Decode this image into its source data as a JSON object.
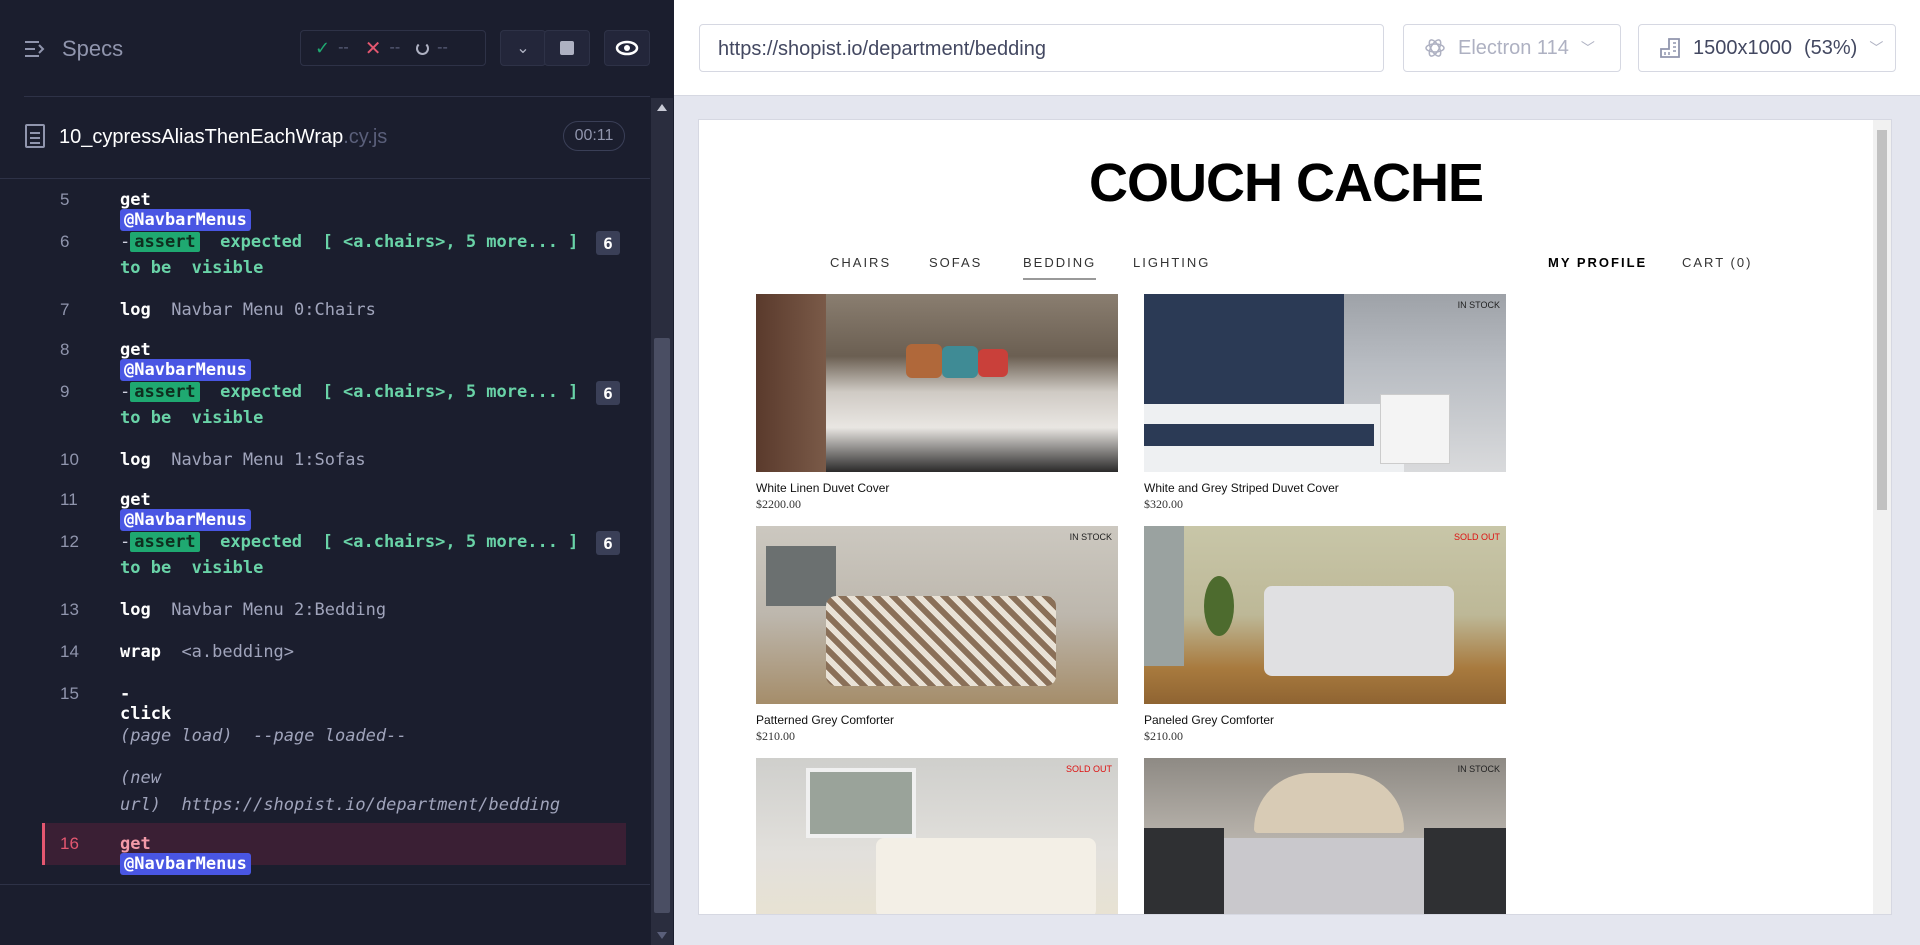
{
  "specs_panel": {
    "label": "Specs",
    "passed": "--",
    "failed": "--",
    "pending": "--"
  },
  "spec_file": {
    "name": "10_cypressAliasThenEachWrap",
    "ext": ".cy.js",
    "duration": "00:11"
  },
  "commands": [
    {
      "num": "5",
      "name": "get",
      "alias": "@NavbarMenus"
    },
    {
      "num": "6",
      "prefix": "-",
      "badge": "assert",
      "text": "expected",
      "target": "[ <a.chairs>, 5 more... ]",
      "count": "6",
      "line2_a": "to be",
      "line2_b": "visible"
    },
    {
      "num": "7",
      "name": "log",
      "message": "Navbar Menu 0:Chairs"
    },
    {
      "num": "8",
      "name": "get",
      "alias": "@NavbarMenus"
    },
    {
      "num": "9",
      "prefix": "-",
      "badge": "assert",
      "text": "expected",
      "target": "[ <a.chairs>, 5 more... ]",
      "count": "6",
      "line2_a": "to be",
      "line2_b": "visible"
    },
    {
      "num": "10",
      "name": "log",
      "message": "Navbar Menu 1:Sofas"
    },
    {
      "num": "11",
      "name": "get",
      "alias": "@NavbarMenus"
    },
    {
      "num": "12",
      "prefix": "-",
      "badge": "assert",
      "text": "expected",
      "target": "[ <a.chairs>, 5 more... ]",
      "count": "6",
      "line2_a": "to be",
      "line2_b": "visible"
    },
    {
      "num": "13",
      "name": "log",
      "message": "Navbar Menu 2:Bedding"
    },
    {
      "num": "14",
      "name": "wrap",
      "message": "<a.bedding>"
    },
    {
      "num": "15",
      "name": "-click"
    },
    {
      "event_a": "(page load)",
      "event_b": "--page loaded--"
    },
    {
      "event_a": "(new",
      "event_c": "url)",
      "event_b": "https://shopist.io/department/bedding"
    },
    {
      "num": "16",
      "name": "get",
      "alias": "@NavbarMenus"
    }
  ],
  "browser_bar": {
    "url": "https://shopist.io/department/bedding",
    "browser": "Electron 114",
    "viewport": "1500x1000",
    "scale": "(53%)"
  },
  "site": {
    "title": "COUCH CACHE",
    "nav": [
      "CHAIRS",
      "SOFAS",
      "BEDDING",
      "LIGHTING"
    ],
    "profile": "MY PROFILE",
    "cart": "CART (0)"
  },
  "products": [
    {
      "name": "White Linen Duvet Cover",
      "price": "$2200.00",
      "badge": ""
    },
    {
      "name": "White and Grey Striped Duvet Cover",
      "price": "$320.00",
      "badge": "IN STOCK"
    },
    {
      "name": "Patterned Grey Comforter",
      "price": "$210.00",
      "badge": "IN STOCK"
    },
    {
      "name": "Paneled Grey Comforter",
      "price": "$210.00",
      "badge": "SOLD OUT"
    },
    {
      "name": "",
      "price": "",
      "badge": "SOLD OUT"
    },
    {
      "name": "",
      "price": "",
      "badge": "IN STOCK"
    }
  ],
  "colors": {
    "panel_bg": "#1b1e2e",
    "alias_blue": "#4956e3",
    "assert_green": "#1fa971",
    "active_red": "#e45770",
    "sold_out": "#dd1111"
  }
}
